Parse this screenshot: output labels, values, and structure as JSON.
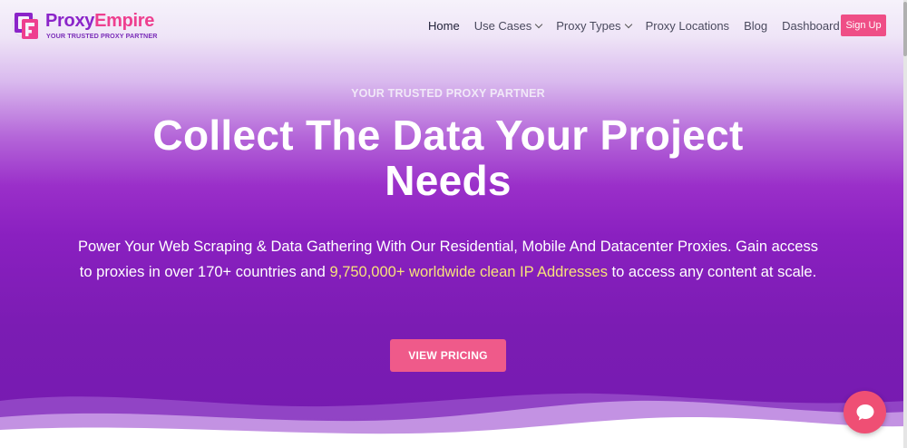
{
  "header": {
    "brand_part1": "Proxy",
    "brand_part2": "Empire",
    "tagline": "YOUR TRUSTED PROXY PARTNER",
    "logo_icon": "proxyempire-logo-icon",
    "nav": {
      "home": "Home",
      "use_cases": "Use Cases",
      "proxy_types": "Proxy Types",
      "proxy_locations": "Proxy Locations",
      "blog": "Blog",
      "dashboard": "Dashboard"
    },
    "signup": "Sign Up"
  },
  "hero": {
    "eyebrow": "YOUR TRUSTED PROXY PARTNER",
    "headline_line1": "Collect The Data Your Project",
    "headline_line2": "Needs",
    "lead_part1": "Power Your Web Scraping & Data Gathering With Our Residential, Mobile And Datacenter Proxies. Gain access to proxies in over 170+ countries and ",
    "lead_highlight": "9,750,000+ worldwide clean IP Addresses",
    "lead_part2": " to access any content at scale.",
    "cta": "VIEW PRICING"
  },
  "chat_widget": {
    "icon": "chat-bubble-icon"
  },
  "colors": {
    "brand_purple": "#8b24c9",
    "brand_pink": "#ee3f8f",
    "hero_purple": "#7b1cb3",
    "highlight_yellow": "#f7e27a",
    "button_pink": "#ef5a8a"
  }
}
